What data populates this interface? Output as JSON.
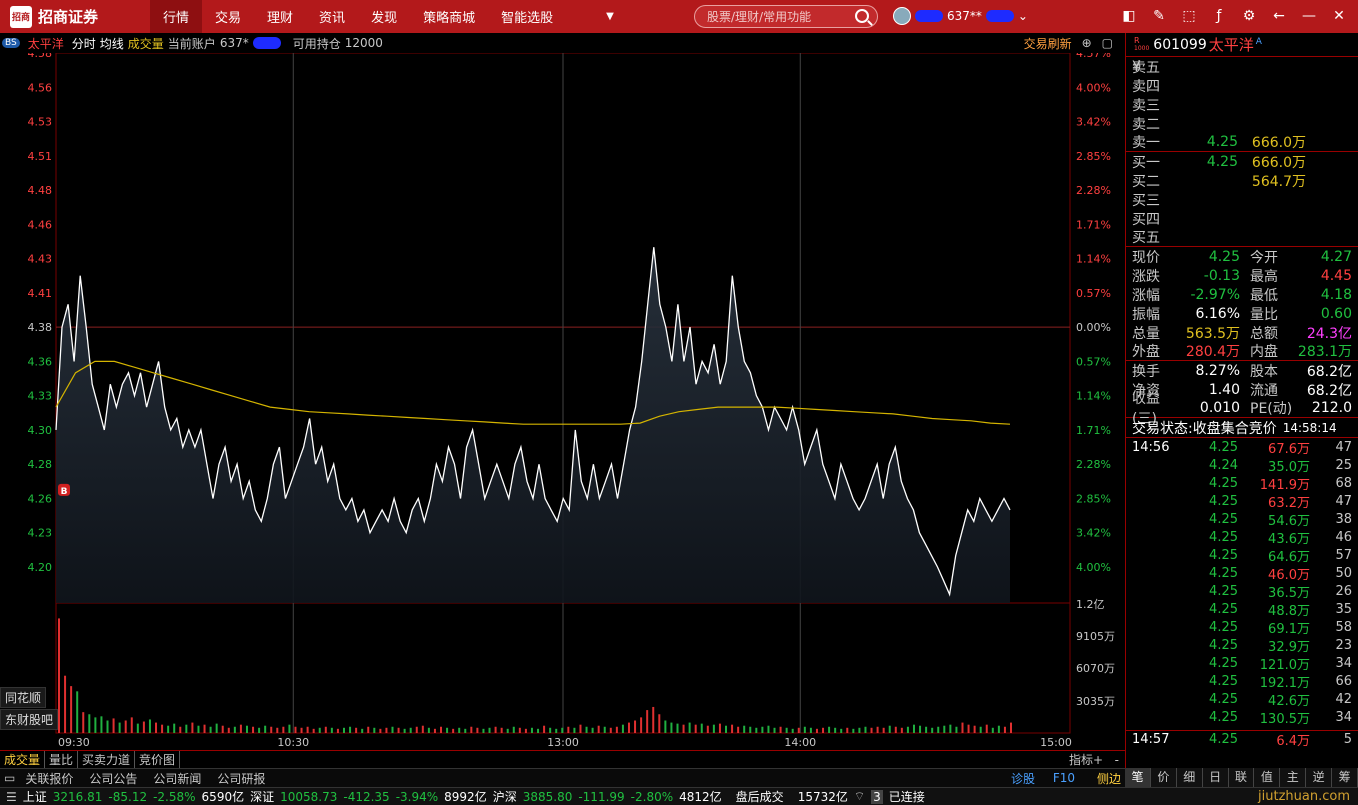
{
  "app": {
    "logo_mark": "招商",
    "logo_text": "招商证券"
  },
  "nav": [
    "行情",
    "交易",
    "理财",
    "资讯",
    "发现",
    "策略商城",
    "智能选股"
  ],
  "search": {
    "placeholder": "股票/理财/常用功能"
  },
  "user": {
    "account": "637**"
  },
  "chart_header": {
    "badge": "BS",
    "name": "太平洋",
    "mode1": "分时",
    "mode2": "均线",
    "mode3": "成交量",
    "account_label": "当前账户",
    "account": "637*",
    "holding_label": "可用持仓",
    "holding": "12000",
    "refresh": "交易刷新"
  },
  "chart_data": {
    "type": "line",
    "title": "",
    "x_ticks": [
      "09:30",
      "10:30",
      "13:00",
      "14:00",
      "15:00"
    ],
    "y_ticks_price": [
      "4.58",
      "4.56",
      "4.53",
      "4.51",
      "4.48",
      "4.46",
      "4.43",
      "4.41",
      "4.38",
      "4.36",
      "4.33",
      "4.30",
      "4.28",
      "4.26",
      "4.23",
      "4.20"
    ],
    "y_ticks_pct": [
      "4.57%",
      "4.00%",
      "3.42%",
      "2.85%",
      "2.28%",
      "1.71%",
      "1.14%",
      "0.57%",
      "0.00%",
      "0.57%",
      "1.14%",
      "1.71%",
      "2.28%",
      "2.85%",
      "3.42%",
      "4.00%"
    ],
    "vol_ticks": [
      "1.2亿",
      "9105万",
      "6070万",
      "3035万"
    ],
    "prev_close": 4.38,
    "ylim": [
      4.18,
      4.58
    ],
    "price": [
      4.3,
      4.38,
      4.4,
      4.36,
      4.42,
      4.38,
      4.34,
      4.32,
      4.3,
      4.34,
      4.32,
      4.34,
      4.35,
      4.33,
      4.35,
      4.32,
      4.34,
      4.36,
      4.32,
      4.3,
      4.31,
      4.29,
      4.3,
      4.29,
      4.3,
      4.28,
      4.26,
      4.28,
      4.29,
      4.27,
      4.28,
      4.26,
      4.27,
      4.25,
      4.24,
      4.26,
      4.28,
      4.29,
      4.26,
      4.27,
      4.28,
      4.29,
      4.31,
      4.28,
      4.29,
      4.27,
      4.28,
      4.26,
      4.25,
      4.26,
      4.24,
      4.25,
      4.23,
      4.24,
      4.25,
      4.24,
      4.26,
      4.24,
      4.23,
      4.25,
      4.26,
      4.24,
      4.26,
      4.28,
      4.27,
      4.29,
      4.28,
      4.26,
      4.29,
      4.3,
      4.28,
      4.26,
      4.27,
      4.28,
      4.27,
      4.26,
      4.28,
      4.29,
      4.27,
      4.26,
      4.28,
      4.26,
      4.25,
      4.24,
      4.26,
      4.25,
      4.3,
      4.27,
      4.26,
      4.28,
      4.26,
      4.27,
      4.28,
      4.26,
      4.28,
      4.3,
      4.32,
      4.36,
      4.4,
      4.44,
      4.4,
      4.38,
      4.36,
      4.4,
      4.36,
      4.38,
      4.34,
      4.36,
      4.35,
      4.37,
      4.34,
      4.36,
      4.42,
      4.38,
      4.36,
      4.35,
      4.33,
      4.32,
      4.3,
      4.32,
      4.31,
      4.3,
      4.32,
      4.3,
      4.28,
      4.29,
      4.3,
      4.28,
      4.27,
      4.26,
      4.28,
      4.27,
      4.26,
      4.25,
      4.26,
      4.27,
      4.28,
      4.26,
      4.28,
      4.29,
      4.27,
      4.26,
      4.25,
      4.23,
      4.22,
      4.21,
      4.2,
      4.19,
      4.18,
      4.21,
      4.23,
      4.25,
      4.24,
      4.26,
      4.25,
      4.24,
      4.25,
      4.26,
      4.25
    ],
    "avg": [
      4.32,
      4.35,
      4.36,
      4.36,
      4.355,
      4.35,
      4.345,
      4.34,
      4.335,
      4.33,
      4.325,
      4.32,
      4.318,
      4.316,
      4.315,
      4.314,
      4.313,
      4.312,
      4.311,
      4.31,
      4.309,
      4.308,
      4.307,
      4.306,
      4.305,
      4.305,
      4.305,
      4.305,
      4.305,
      4.305,
      4.306,
      4.312,
      4.316,
      4.318,
      4.32,
      4.32,
      4.32,
      4.32,
      4.319,
      4.318,
      4.317,
      4.316,
      4.315,
      4.314,
      4.312,
      4.31,
      4.309,
      4.308,
      4.306,
      4.305
    ],
    "volume_max": 120000000,
    "volume": [
      1.1,
      0.55,
      0.45,
      0.4,
      0.2,
      0.18,
      0.15,
      0.16,
      0.12,
      0.14,
      0.1,
      0.12,
      0.15,
      0.09,
      0.11,
      0.13,
      0.1,
      0.08,
      0.07,
      0.09,
      0.06,
      0.08,
      0.1,
      0.07,
      0.08,
      0.06,
      0.09,
      0.07,
      0.05,
      0.06,
      0.08,
      0.07,
      0.06,
      0.05,
      0.07,
      0.06,
      0.05,
      0.06,
      0.08,
      0.06,
      0.05,
      0.06,
      0.04,
      0.05,
      0.06,
      0.05,
      0.04,
      0.05,
      0.06,
      0.05,
      0.04,
      0.06,
      0.05,
      0.04,
      0.05,
      0.06,
      0.05,
      0.04,
      0.05,
      0.06,
      0.07,
      0.05,
      0.04,
      0.06,
      0.05,
      0.04,
      0.05,
      0.04,
      0.06,
      0.05,
      0.04,
      0.05,
      0.06,
      0.05,
      0.04,
      0.06,
      0.05,
      0.04,
      0.05,
      0.04,
      0.07,
      0.05,
      0.04,
      0.05,
      0.06,
      0.05,
      0.08,
      0.06,
      0.05,
      0.07,
      0.06,
      0.05,
      0.06,
      0.08,
      0.1,
      0.12,
      0.15,
      0.22,
      0.25,
      0.18,
      0.12,
      0.1,
      0.09,
      0.08,
      0.1,
      0.08,
      0.09,
      0.07,
      0.08,
      0.09,
      0.07,
      0.08,
      0.06,
      0.07,
      0.06,
      0.05,
      0.06,
      0.07,
      0.05,
      0.06,
      0.05,
      0.04,
      0.05,
      0.06,
      0.05,
      0.04,
      0.05,
      0.06,
      0.05,
      0.04,
      0.05,
      0.04,
      0.05,
      0.06,
      0.05,
      0.06,
      0.05,
      0.07,
      0.06,
      0.05,
      0.06,
      0.08,
      0.07,
      0.06,
      0.05,
      0.06,
      0.07,
      0.08,
      0.06,
      0.1,
      0.08,
      0.07,
      0.06,
      0.08,
      0.05,
      0.07,
      0.06,
      0.1
    ]
  },
  "quote": {
    "code": "601099",
    "name": "太平洋",
    "r_badge_top": "R",
    "r_badge_bottom": "1000",
    "currency": "¥",
    "sell": [
      {
        "label": "卖五",
        "price": "",
        "vol": ""
      },
      {
        "label": "卖四",
        "price": "",
        "vol": ""
      },
      {
        "label": "卖三",
        "price": "",
        "vol": ""
      },
      {
        "label": "卖二",
        "price": "",
        "vol": ""
      },
      {
        "label": "卖一",
        "price": "4.25",
        "vol": "666.0万"
      }
    ],
    "buy": [
      {
        "label": "买一",
        "price": "4.25",
        "vol": "666.0万"
      },
      {
        "label": "买二",
        "price": "",
        "vol": "564.7万"
      },
      {
        "label": "买三",
        "price": "",
        "vol": ""
      },
      {
        "label": "买四",
        "price": "",
        "vol": ""
      },
      {
        "label": "买五",
        "price": "",
        "vol": ""
      }
    ],
    "stats": [
      {
        "l1": "现价",
        "v1": "4.25",
        "c1": "green",
        "l2": "今开",
        "v2": "4.27",
        "c2": "green"
      },
      {
        "l1": "涨跌",
        "v1": "-0.13",
        "c1": "green",
        "l2": "最高",
        "v2": "4.45",
        "c2": "red"
      },
      {
        "l1": "涨幅",
        "v1": "-2.97%",
        "c1": "green",
        "l2": "最低",
        "v2": "4.18",
        "c2": "green"
      },
      {
        "l1": "振幅",
        "v1": "6.16%",
        "c1": "white",
        "l2": "量比",
        "v2": "0.60",
        "c2": "green"
      },
      {
        "l1": "总量",
        "v1": "563.5万",
        "c1": "yellow",
        "l2": "总额",
        "v2": "24.3亿",
        "c2": "magenta"
      },
      {
        "l1": "外盘",
        "v1": "280.4万",
        "c1": "red",
        "l2": "内盘",
        "v2": "283.1万",
        "c2": "green"
      }
    ],
    "stats2": [
      {
        "l1": "换手",
        "v1": "8.27%",
        "l2": "股本",
        "v2": "68.2亿"
      },
      {
        "l1": "净资",
        "v1": "1.40",
        "l2": "流通",
        "v2": "68.2亿"
      },
      {
        "l1": "收益(三)",
        "v1": "0.010",
        "l2": "PE(动)",
        "v2": "212.0"
      }
    ],
    "trade_state_label": "交易状态:",
    "trade_state": "收盘集合竞价",
    "trade_time": "14:58:14"
  },
  "ticks": [
    {
      "time": "14:56",
      "price": "4.25",
      "vol": "67.6万",
      "dir": "red",
      "cnt": "47"
    },
    {
      "time": "",
      "price": "4.24",
      "vol": "35.0万",
      "dir": "green",
      "cnt": "25"
    },
    {
      "time": "",
      "price": "4.25",
      "vol": "141.9万",
      "dir": "red",
      "cnt": "68"
    },
    {
      "time": "",
      "price": "4.25",
      "vol": "63.2万",
      "dir": "red",
      "cnt": "47"
    },
    {
      "time": "",
      "price": "4.25",
      "vol": "54.6万",
      "dir": "green",
      "cnt": "38"
    },
    {
      "time": "",
      "price": "4.25",
      "vol": "43.6万",
      "dir": "green",
      "cnt": "46"
    },
    {
      "time": "",
      "price": "4.25",
      "vol": "64.6万",
      "dir": "green",
      "cnt": "57"
    },
    {
      "time": "",
      "price": "4.25",
      "vol": "46.0万",
      "dir": "red",
      "cnt": "50"
    },
    {
      "time": "",
      "price": "4.25",
      "vol": "36.5万",
      "dir": "green",
      "cnt": "26"
    },
    {
      "time": "",
      "price": "4.25",
      "vol": "48.8万",
      "dir": "green",
      "cnt": "35"
    },
    {
      "time": "",
      "price": "4.25",
      "vol": "69.1万",
      "dir": "green",
      "cnt": "58"
    },
    {
      "time": "",
      "price": "4.25",
      "vol": "32.9万",
      "dir": "green",
      "cnt": "23"
    },
    {
      "time": "",
      "price": "4.25",
      "vol": "121.0万",
      "dir": "green",
      "cnt": "34"
    },
    {
      "time": "",
      "price": "4.25",
      "vol": "192.1万",
      "dir": "green",
      "cnt": "66"
    },
    {
      "time": "",
      "price": "4.25",
      "vol": "42.6万",
      "dir": "green",
      "cnt": "42"
    },
    {
      "time": "",
      "price": "4.25",
      "vol": "130.5万",
      "dir": "green",
      "cnt": "34"
    },
    {
      "time": "14:57",
      "price": "4.25",
      "vol": "6.4万",
      "dir": "red",
      "cnt": "5"
    }
  ],
  "side_widgets": [
    "同花顺",
    "东财股吧"
  ],
  "bottom_tabs": [
    "成交量",
    "量比",
    "买卖力道",
    "竞价图"
  ],
  "bottom_right": {
    "indicator": "指标",
    "plus": "+",
    "minus": "-"
  },
  "news_tabs": [
    "关联报价",
    "公司公告",
    "公司新闻",
    "公司研报"
  ],
  "news_right": {
    "diag": "诊股",
    "f10": "F10",
    "side": "侧边"
  },
  "right_tabs": [
    "笔",
    "价",
    "细",
    "日",
    "联",
    "值",
    "主",
    "逆",
    "筹"
  ],
  "status": {
    "sh_label": "上证",
    "sh_val": "3216.81",
    "sh_chg": "-85.12",
    "sh_pct": "-2.58%",
    "sh_amt": "6590亿",
    "sz_label": "深证",
    "sz_val": "10058.73",
    "sz_chg": "-412.35",
    "sz_pct": "-3.94%",
    "sz_amt": "8992亿",
    "hs_label": "沪深",
    "hs_val": "3885.80",
    "hs_chg": "-111.99",
    "hs_pct": "-2.80%",
    "hs_amt": "4812亿",
    "auction": "盘后成交",
    "auction_amt": "15732亿",
    "conn": "已连接",
    "conn_count": "3",
    "watermark": "jiutzhuan.com"
  },
  "colors": {
    "brand": "#b3191b",
    "up": "#ff4040",
    "down": "#20c040",
    "avg_line": "#d4b400",
    "price_line": "#ffffff"
  }
}
